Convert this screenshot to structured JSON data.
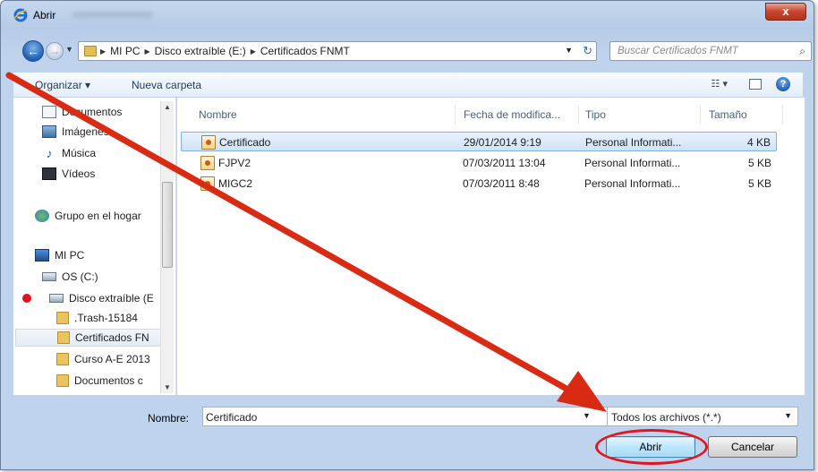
{
  "window": {
    "title": "Abrir",
    "close_label": "x"
  },
  "nav": {
    "back_glyph": "←",
    "forward_glyph": "→",
    "history_glyph": "▼",
    "breadcrumbs": [
      "MI PC",
      "Disco extraíble (E:)",
      "Certificados FNMT"
    ],
    "crumb_separator": "▶",
    "dropdown_glyph": "▼",
    "refresh_glyph": "↻",
    "search_placeholder": "Buscar Certificados FNMT",
    "search_glyph": "⌕"
  },
  "toolbar": {
    "organize": "Organizar ▾",
    "new_folder": "Nueva carpeta",
    "views_glyph": "☷ ▾",
    "help": "?"
  },
  "sidebar": {
    "items": [
      {
        "label": "Documentos",
        "icon": "documents-icon"
      },
      {
        "label": "Imágenes",
        "icon": "pictures-icon"
      },
      {
        "label": "Música",
        "icon": "music-icon",
        "glyph": "♪"
      },
      {
        "label": "Vídeos",
        "icon": "videos-icon"
      },
      {
        "label": "Grupo en el hogar",
        "icon": "homegroup-icon"
      },
      {
        "label": "MI PC",
        "icon": "computer-icon"
      },
      {
        "label": "OS (C:)",
        "icon": "drive-icon"
      },
      {
        "label": "Disco extraíble (E",
        "icon": "removable-drive-icon"
      },
      {
        "label": ".Trash-15184",
        "icon": "folder-icon"
      },
      {
        "label": "Certificados FN",
        "icon": "folder-icon"
      },
      {
        "label": "Curso A-E 2013",
        "icon": "folder-icon"
      },
      {
        "label": "Documentos c",
        "icon": "folder-icon"
      }
    ],
    "scroll_up": "▲",
    "scroll_down": "▼"
  },
  "files": {
    "columns": [
      "Nombre",
      "Fecha de modifica...",
      "Tipo",
      "Tamaño"
    ],
    "rows": [
      {
        "name": "Certificado",
        "date": "29/01/2014 9:19",
        "type": "Personal Informati...",
        "size": "4 KB"
      },
      {
        "name": "FJPV2",
        "date": "07/03/2011 13:04",
        "type": "Personal Informati...",
        "size": "5 KB"
      },
      {
        "name": "MIGC2",
        "date": "07/03/2011 8:48",
        "type": "Personal Informati...",
        "size": "5 KB"
      }
    ]
  },
  "footer": {
    "name_label": "Nombre:",
    "name_value": "Certificado",
    "dropdown_glyph": "▼",
    "file_type": "Todos los archivos (*.*)",
    "open_button": "Abrir",
    "cancel_button": "Cancelar"
  },
  "annotations": {
    "arrow_color": "#d92a14",
    "marker_color": "#e2111d"
  }
}
